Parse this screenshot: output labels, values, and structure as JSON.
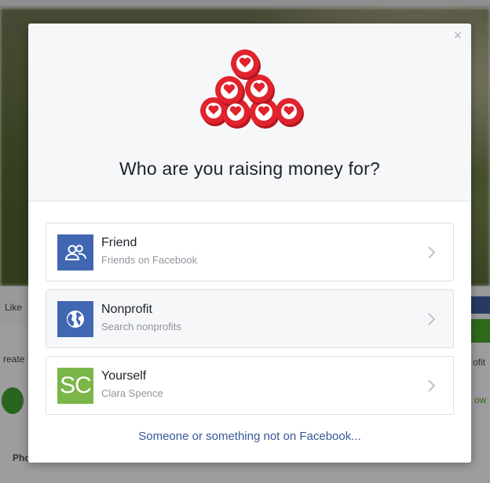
{
  "background": {
    "liked_label": "Like",
    "create_label": "reate",
    "photo_label": "Pho",
    "profit_label": "ofit",
    "how_label": "ow"
  },
  "modal": {
    "close_glyph": "×",
    "title": "Who are you raising money for?",
    "options": [
      {
        "title": "Friend",
        "subtitle": "Friends on Facebook",
        "icon": "people-icon"
      },
      {
        "title": "Nonprofit",
        "subtitle": "Search nonprofits",
        "icon": "globe-icon"
      },
      {
        "title": "Yourself",
        "subtitle": "Clara Spence",
        "icon": "avatar-initials",
        "initials": "SC"
      }
    ],
    "footer_link": "Someone or something not on Facebook..."
  },
  "colors": {
    "facebook_blue": "#4267b2",
    "link_blue": "#365899",
    "heart_red": "#e0232d",
    "avatar_green": "#7ab648",
    "arrow_green": "#4aa02c"
  }
}
